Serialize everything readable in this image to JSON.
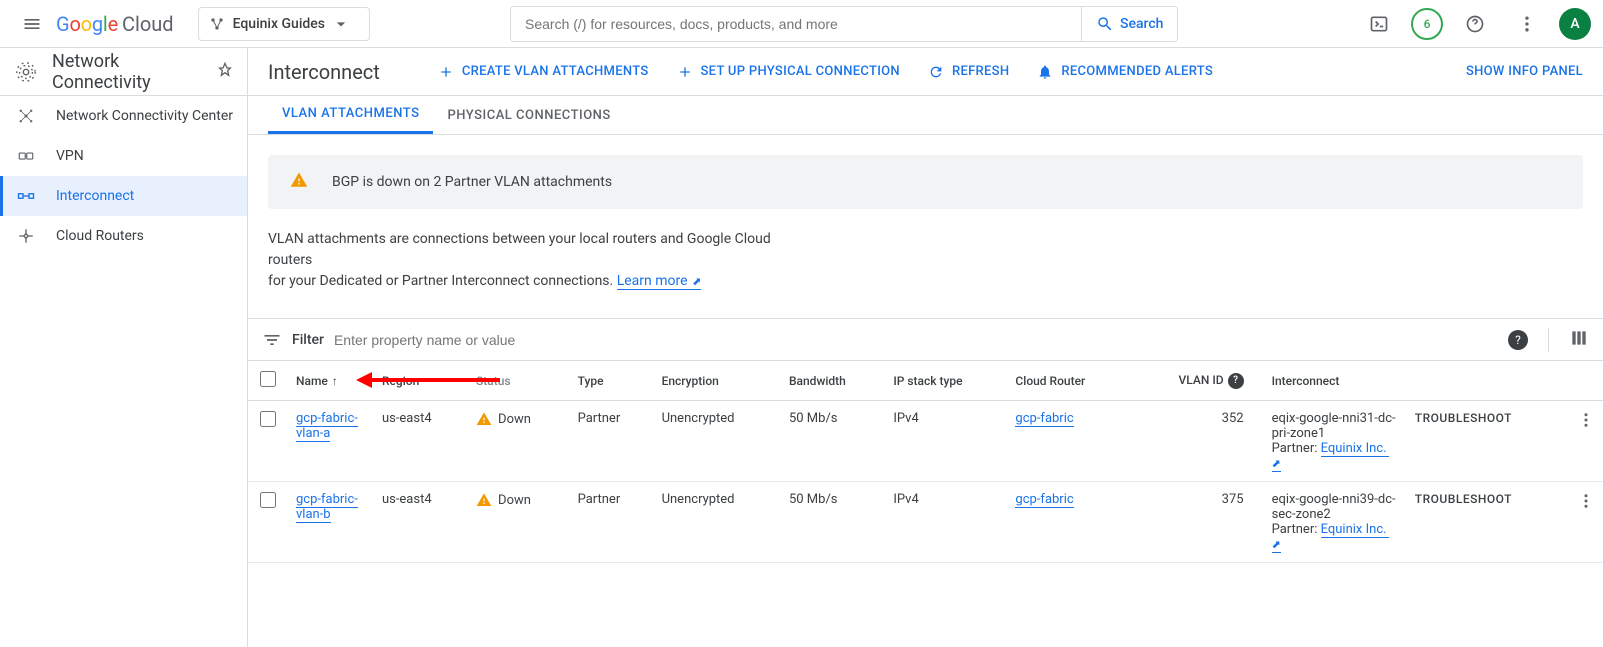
{
  "header": {
    "logo_cloud": "Cloud",
    "project_name": "Equinix Guides",
    "search_placeholder": "Search (/) for resources, docs, products, and more",
    "search_button": "Search",
    "trial_badge": "6",
    "avatar_letter": "A"
  },
  "sidebar": {
    "title": "Network Connectivity",
    "items": [
      {
        "key": "ncc",
        "label": "Network Connectivity Center"
      },
      {
        "key": "vpn",
        "label": "VPN"
      },
      {
        "key": "interconnect",
        "label": "Interconnect"
      },
      {
        "key": "cloud-routers",
        "label": "Cloud Routers"
      }
    ]
  },
  "content_header": {
    "title": "Interconnect",
    "create_vlan": "CREATE VLAN ATTACHMENTS",
    "setup_physical": "SET UP PHYSICAL CONNECTION",
    "refresh": "REFRESH",
    "recommended": "RECOMMENDED ALERTS",
    "show_info": "SHOW INFO PANEL"
  },
  "tabs": {
    "vlan": "VLAN ATTACHMENTS",
    "physical": "PHYSICAL CONNECTIONS"
  },
  "alert": {
    "message": "BGP is down on 2 Partner VLAN attachments"
  },
  "description": {
    "line1": "VLAN attachments are connections between your local routers and Google Cloud routers",
    "line2": "for your Dedicated or Partner Interconnect connections. ",
    "learn_more": "Learn more"
  },
  "filter": {
    "label": "Filter",
    "placeholder": "Enter property name or value"
  },
  "table": {
    "headers": {
      "name": "Name",
      "region": "Region",
      "status": "Status",
      "type": "Type",
      "encryption": "Encryption",
      "bandwidth": "Bandwidth",
      "ip_stack": "IP stack type",
      "cloud_router": "Cloud Router",
      "vlan_id": "VLAN ID",
      "interconnect": "Interconnect"
    },
    "rows": [
      {
        "name": "gcp-fabric-vlan-a",
        "region": "us-east4",
        "status": "Down",
        "type": "Partner",
        "encryption": "Unencrypted",
        "bandwidth": "50 Mb/s",
        "ip_stack": "IPv4",
        "cloud_router": "gcp-fabric",
        "vlan_id": "352",
        "interconnect": "eqix-google-nni31-dc-pri-zone1",
        "partner_label": "Partner: ",
        "partner_name": "Equinix Inc.",
        "troubleshoot": "TROUBLESHOOT"
      },
      {
        "name": "gcp-fabric-vlan-b",
        "region": "us-east4",
        "status": "Down",
        "type": "Partner",
        "encryption": "Unencrypted",
        "bandwidth": "50 Mb/s",
        "ip_stack": "IPv4",
        "cloud_router": "gcp-fabric",
        "vlan_id": "375",
        "interconnect": "eqix-google-nni39-dc-sec-zone2",
        "partner_label": "Partner: ",
        "partner_name": "Equinix Inc.",
        "troubleshoot": "TROUBLESHOOT"
      }
    ]
  }
}
